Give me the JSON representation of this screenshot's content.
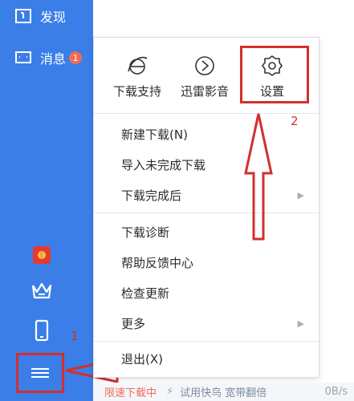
{
  "sidebar": {
    "items": [
      {
        "label": "发现",
        "icon": "discover-icon"
      },
      {
        "label": "消息",
        "icon": "message-icon",
        "badge": "1"
      }
    ],
    "bottom_icons": [
      "gift-icon",
      "crown-icon",
      "phone-icon",
      "menu-icon"
    ]
  },
  "popup": {
    "tools": [
      {
        "label": "下载支持",
        "icon": "ie-icon"
      },
      {
        "label": "迅雷影音",
        "icon": "play-icon"
      },
      {
        "label": "设置",
        "icon": "gear-icon"
      }
    ],
    "items": [
      {
        "label": "新建下载(N)"
      },
      {
        "label": "导入未完成下载"
      },
      {
        "label": "下载完成后",
        "submenu": true
      },
      {
        "label": "下载诊断"
      },
      {
        "label": "帮助反馈中心"
      },
      {
        "label": "检查更新"
      },
      {
        "label": "更多",
        "submenu": true
      },
      {
        "label": "退出(X)"
      }
    ]
  },
  "status": {
    "slow_label": "限速下载中",
    "trial_label": "试用快鸟 宽带翻倍",
    "speed": "0B/s"
  },
  "annotations": {
    "step1": "1",
    "step2": "2"
  },
  "colors": {
    "sidebar": "#3b7ee8",
    "highlight": "#d32f2f",
    "badge": "#f26a57",
    "slow_text": "#f06d59"
  }
}
